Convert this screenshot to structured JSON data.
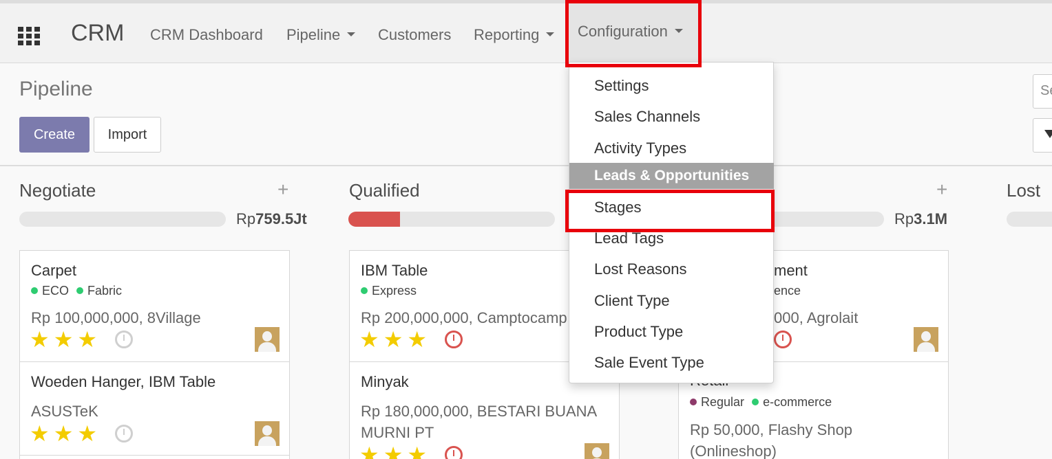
{
  "nav": {
    "brand": "CRM",
    "items": [
      {
        "label": "CRM Dashboard",
        "caret": false
      },
      {
        "label": "Pipeline",
        "caret": true
      },
      {
        "label": "Customers",
        "caret": false
      },
      {
        "label": "Reporting",
        "caret": true
      },
      {
        "label": "Configuration",
        "caret": true
      }
    ]
  },
  "control": {
    "title": "Pipeline",
    "create_label": "Create",
    "import_label": "Import",
    "search_placeholder": "Se"
  },
  "columns": [
    {
      "title": "Negotiate",
      "total_prefix": "Rp",
      "total_value": "759.5Jt",
      "progress_fraction": 0.0
    },
    {
      "title": "Qualified",
      "progress_fraction": 0.25
    },
    {
      "title": "",
      "total_prefix": "Rp",
      "total_value": "3.1M"
    },
    {
      "title": "Lost"
    }
  ],
  "cards": {
    "negotiate": [
      {
        "title": "Carpet",
        "tags": [
          "ECO",
          "Fabric"
        ],
        "amount": "Rp 100,000,000, 8Village",
        "stars": "★★★",
        "clock": "grey"
      },
      {
        "title": "Woeden Hanger, IBM Table",
        "amount": "ASUSTeK",
        "stars": "★★★",
        "clock": "grey"
      }
    ],
    "qualified": [
      {
        "title": "IBM Table",
        "tags": [
          "Express"
        ],
        "amount": "Rp 200,000,000, Camptocamp",
        "stars": "★★★",
        "clock": "red"
      },
      {
        "title": "Minyak",
        "amount_line1": "Rp 180,000,000, BESTARI BUANA",
        "amount_line2": "MURNI PT",
        "stars": "★★★",
        "clock": "red"
      }
    ],
    "third": [
      {
        "title_partial": "ment",
        "tag_partial": "ence",
        "amount_partial": "000, Agrolait",
        "clock": "red"
      },
      {
        "title_partial": "Retail",
        "tags": [
          "Regular",
          "e-commerce"
        ],
        "amount_line1": "Rp 50,000, Flashy Shop",
        "amount_line2": "(Onlineshop)"
      }
    ]
  },
  "dropdown": {
    "items_top": [
      "Settings",
      "Sales Channels",
      "Activity Types"
    ],
    "header": "Leads & Opportunities",
    "items_bottom": [
      "Stages",
      "Lead Tags",
      "Lost Reasons",
      "Client Type",
      "Product Type",
      "Sale Event Type"
    ]
  },
  "colors": {
    "primary": "#7c7bad",
    "highlight": "#e8000b",
    "star": "#f3cc00",
    "progress_red": "#d9534f",
    "tag_green": "#2ecc71",
    "tag_purple": "#8e3a6a"
  }
}
